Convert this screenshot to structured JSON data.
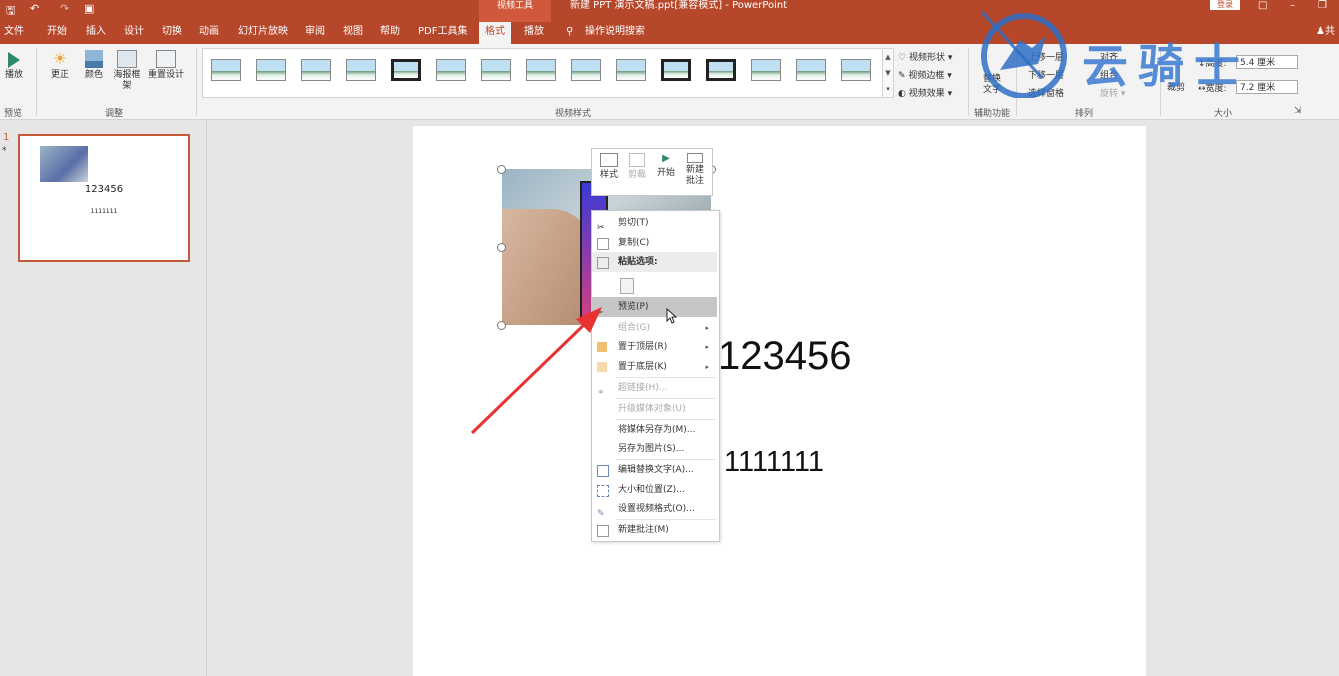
{
  "titlebar": {
    "context_group": "视频工具",
    "title": "新建 PPT 演示文稿.ppt[兼容模式] - PowerPoint",
    "login": "登录"
  },
  "tabs": [
    "文件",
    "开始",
    "插入",
    "设计",
    "切换",
    "动画",
    "幻灯片放映",
    "审阅",
    "视图",
    "帮助",
    "PDF工具集",
    "格式",
    "播放"
  ],
  "active_tab": "格式",
  "tell_me": "操作说明搜索",
  "share": "共",
  "ribbon": {
    "play": "播放",
    "correct": "更正",
    "color": "颜色",
    "poster_frame": "海报框架",
    "reset_design": "重置设计",
    "group_preview": "预览",
    "group_adjust": "调整",
    "group_video_styles": "视频样式",
    "video_shape": "视频形状",
    "video_border": "视频边框",
    "video_effects": "视频效果",
    "alt_text": "替换文字",
    "group_accessibility": "辅助功能",
    "bring_forward": "上移一层",
    "send_backward": "下移一层",
    "selection_pane": "选择窗格",
    "align": "对齐",
    "group": "组合",
    "rotate": "旋转",
    "group_arrange": "排列",
    "crop": "裁剪",
    "height_label": "高度:",
    "height_value": "5.4 厘米",
    "width_label": "宽度:",
    "width_value": "7.2 厘米",
    "group_size": "大小"
  },
  "watermark": "云骑士",
  "slide_panel": {
    "slide_number": "1",
    "star": "*",
    "thumb_title": "123456",
    "thumb_sub": "1111111"
  },
  "slide": {
    "title": "123456",
    "subtitle": "1111111"
  },
  "mini_toolbar": [
    "样式",
    "剪裁",
    "开始",
    "新建批注"
  ],
  "context_menu": [
    {
      "label": "剪切(T)",
      "icon": "scissors-icon"
    },
    {
      "label": "复制(C)",
      "icon": "copy-icon"
    },
    {
      "label": "粘贴选项:",
      "icon": "paste-icon",
      "header": true
    },
    {
      "label": "",
      "icon": "paste-option-icon"
    },
    {
      "label": "预览(P)",
      "icon": "play-icon",
      "highlight": true
    },
    {
      "label": "组合(G)",
      "icon": "group-icon",
      "disabled": true,
      "submenu": true
    },
    {
      "label": "置于顶层(R)",
      "icon": "bring-front-icon",
      "submenu": true
    },
    {
      "label": "置于底层(K)",
      "icon": "send-back-icon",
      "submenu": true
    },
    {
      "label": "超链接(H)...",
      "icon": "link-icon",
      "disabled": true
    },
    {
      "label": "升级媒体对象(U)",
      "icon": "",
      "disabled": true
    },
    {
      "label": "将媒体另存为(M)...",
      "icon": ""
    },
    {
      "label": "另存为图片(S)...",
      "icon": ""
    },
    {
      "label": "编辑替换文字(A)...",
      "icon": "alt-text-icon"
    },
    {
      "label": "大小和位置(Z)...",
      "icon": "size-icon"
    },
    {
      "label": "设置视频格式(O)...",
      "icon": "format-icon"
    },
    {
      "label": "新建批注(M)",
      "icon": "comment-icon"
    }
  ]
}
